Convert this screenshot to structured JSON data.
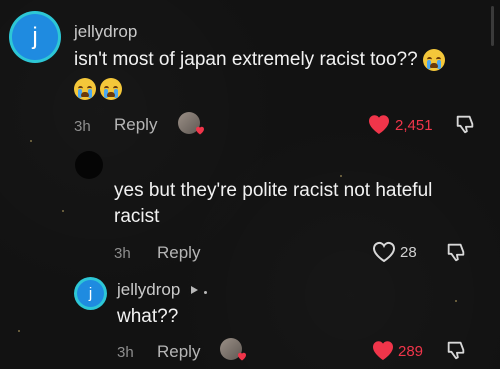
{
  "comments": [
    {
      "avatar_letter": "j",
      "username": "jellydrop",
      "text": "isn't most of japan extremely racist too??",
      "time": "3h",
      "reply_label": "Reply",
      "likes": "2,451",
      "liked": true
    },
    {
      "username": "",
      "text_line1": "yes but they're polite racist not hateful",
      "text_line2": "racist",
      "time": "3h",
      "reply_label": "Reply",
      "likes": "28",
      "liked": false
    },
    {
      "avatar_letter": "j",
      "username": "jellydrop",
      "text": "what??",
      "time": "3h",
      "reply_label": "Reply",
      "likes": "289",
      "liked": true
    }
  ],
  "icons": {
    "emoji": "loudly-crying-face",
    "heart": "heart-icon",
    "dislike": "thumbs-down-icon",
    "play": "play-triangle-icon"
  },
  "colors": {
    "liked_heart": "#f0354a",
    "accent_ring": "#2dc7d6",
    "avatar_fill": "#1f8be0"
  }
}
